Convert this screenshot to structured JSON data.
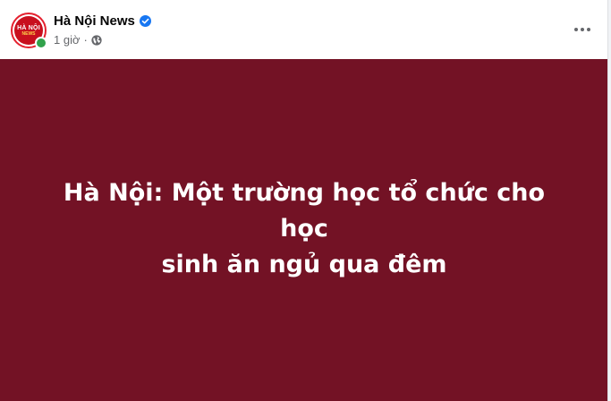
{
  "post": {
    "page_name": "Hà Nội News",
    "verified": true,
    "time": "1 giờ",
    "separator": "·",
    "privacy_icon": "globe-icon",
    "more_icon": "more-options-icon",
    "content_line1": "Hà Nội: Một trường học tổ chức cho học",
    "content_line2": "sinh ăn ngủ qua đêm",
    "background_color": "#731225"
  },
  "avatar": {
    "text_top": "HÀ NỘI",
    "text_bottom": "NEWS"
  },
  "colors": {
    "verified": "#1877f2",
    "online": "#31a24c",
    "meta_text": "#65676b"
  }
}
